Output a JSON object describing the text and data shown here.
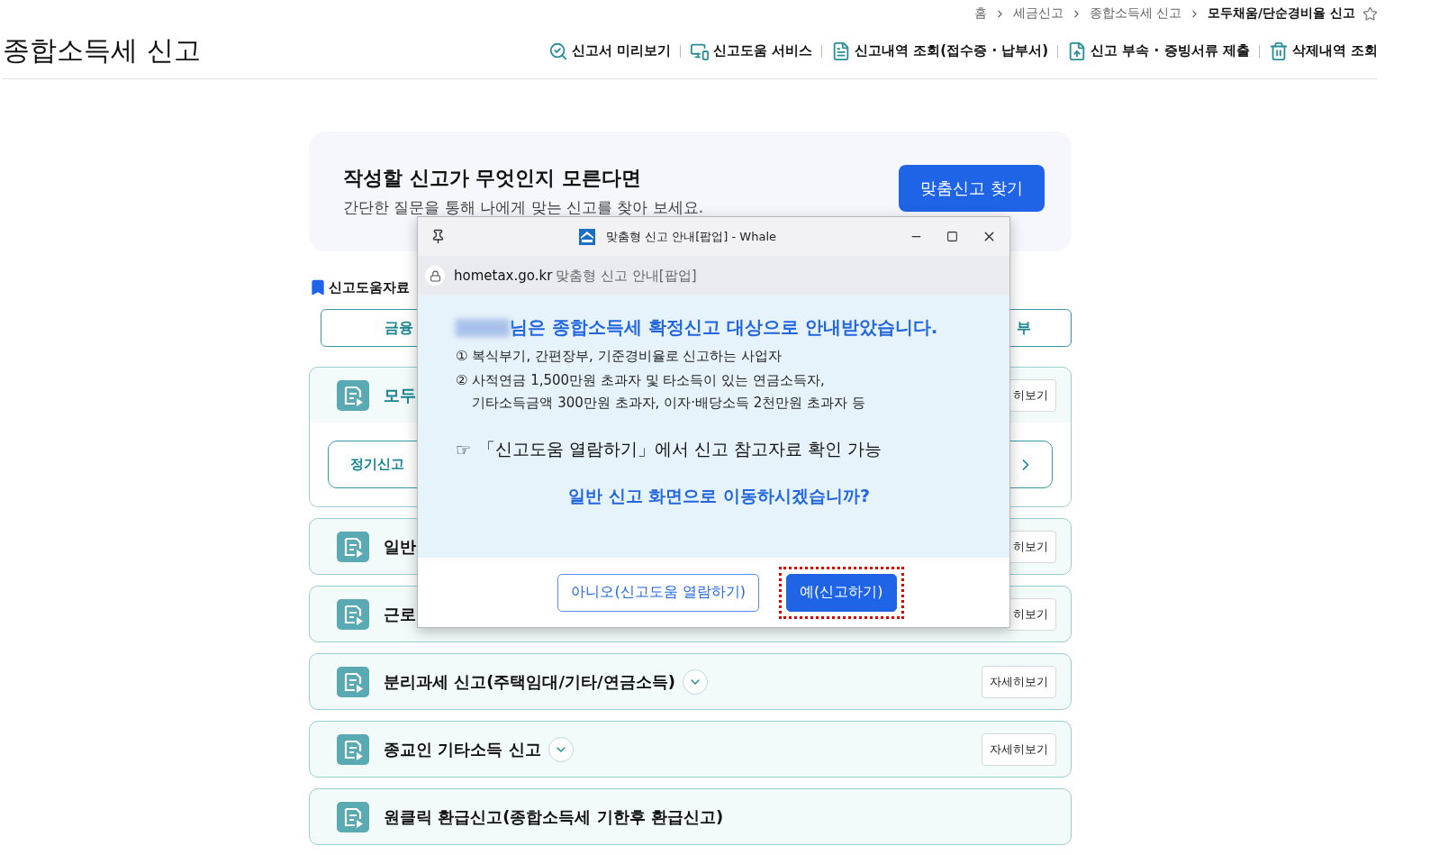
{
  "breadcrumb": [
    {
      "label": "홈",
      "current": false
    },
    {
      "label": "세금신고",
      "current": false
    },
    {
      "label": "종합소득세 신고",
      "current": false
    },
    {
      "label": "모두채움/단순경비율 신고",
      "current": true
    }
  ],
  "page_title": "종합소득세 신고",
  "nav_links": [
    {
      "label": "신고서 미리보기",
      "kind": "preview"
    },
    {
      "label": "신고도움 서비스",
      "kind": "help"
    },
    {
      "label": "신고내역 조회(접수증 · 납부서)",
      "kind": "history"
    },
    {
      "label": "신고 부속 · 증빙서류 제출",
      "kind": "upload"
    },
    {
      "label": "삭제내역 조회",
      "kind": "trash"
    }
  ],
  "banner": {
    "title": "작성할 신고가 무엇인지 모른다면",
    "subtitle": "간단한 질문을 통해 나에게 맞는 신고를 찾아 보세요.",
    "button": "맞춤신고 찾기"
  },
  "help_section": {
    "title": "신고도움자료",
    "tabs": [
      "금융",
      "부"
    ]
  },
  "reports": [
    {
      "title": "모두",
      "chevron": false,
      "detail_button": "히보기",
      "options": [
        "정기신고"
      ]
    },
    {
      "title": "일반",
      "chevron": false,
      "detail_button": "히보기"
    },
    {
      "title": "근로",
      "chevron": false,
      "detail_button": "히보기"
    },
    {
      "title": "분리과세 신고(주택임대/기타/연금소득)",
      "chevron": true,
      "detail_button": "자세히보기"
    },
    {
      "title": "종교인 기타소득 신고",
      "chevron": true,
      "detail_button": "자세히보기"
    },
    {
      "title": "원클릭 환급신고(종합소득세 기한후 환급신고)",
      "chevron": false
    }
  ],
  "popup": {
    "window_title": "맞춤형 신고 안내[팝업] - Whale",
    "url": "hometax.go.kr",
    "page_title": "맞춤형 신고 안내[팝업]",
    "headline": "님은 종합소득세 확정신고 대상으로 안내받았습니다.",
    "items": [
      {
        "marker": "①",
        "lines": [
          "복식부기, 간편장부, 기준경비율로 신고하는 사업자"
        ]
      },
      {
        "marker": "②",
        "lines": [
          "사적연금 1,500만원 초과자 및 타소득이 있는 연금소득자,",
          "기타소득금액 300만원 초과자, 이자·배당소득 2천만원 초과자 등"
        ]
      }
    ],
    "note_marker": "☞",
    "note": "「신고도움 열람하기」에서 신고 참고자료 확인 가능",
    "question": "일반 신고 화면으로 이동하시겠습니까?",
    "buttons": [
      {
        "label": "아니오(신고도움 열람하기)",
        "kind": "secondary",
        "highlighted": false
      },
      {
        "label": "예(신고하기)",
        "kind": "primary",
        "highlighted": true
      }
    ]
  }
}
